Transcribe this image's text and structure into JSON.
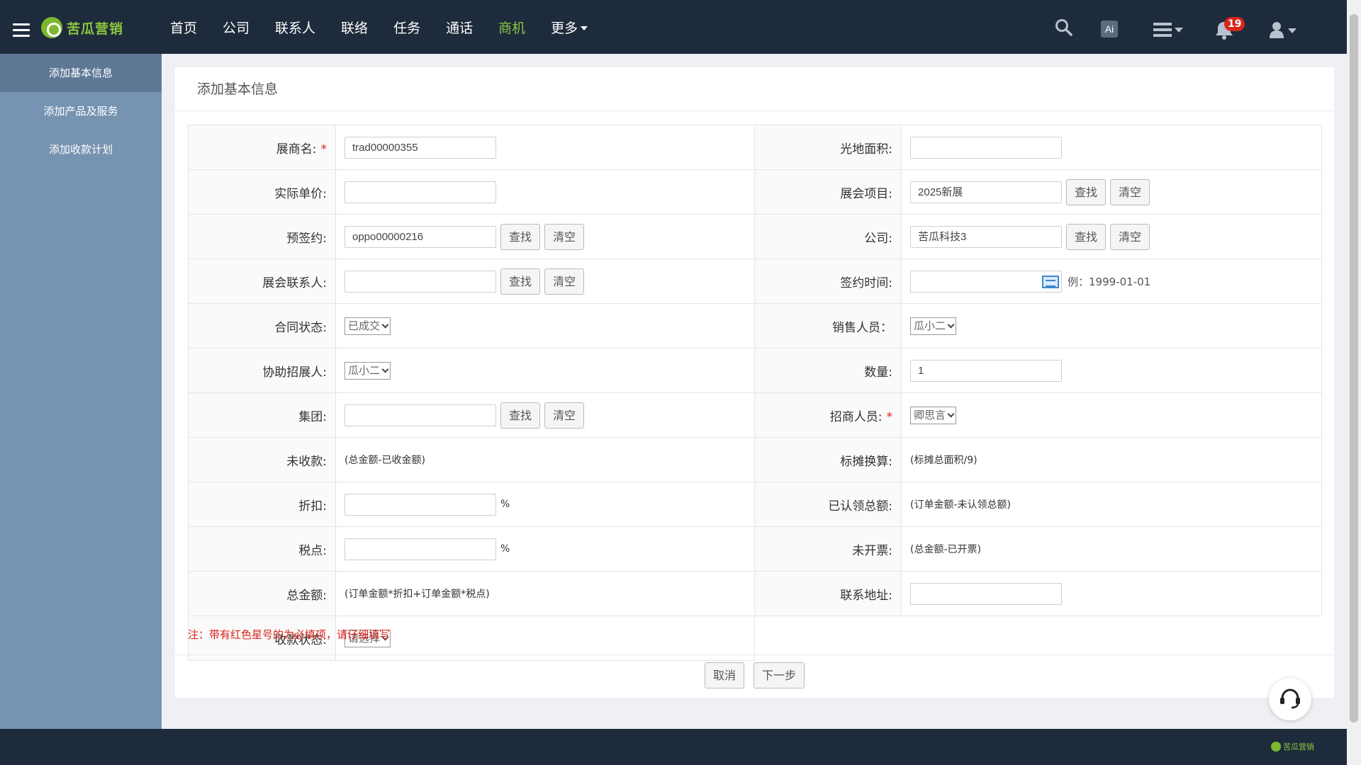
{
  "topbar": {
    "logo_text": "苦瓜营销",
    "nav": [
      {
        "label": "首页",
        "active": false
      },
      {
        "label": "公司",
        "active": false
      },
      {
        "label": "联系人",
        "active": false
      },
      {
        "label": "联络",
        "active": false
      },
      {
        "label": "任务",
        "active": false
      },
      {
        "label": "通话",
        "active": false
      },
      {
        "label": "商机",
        "active": true
      },
      {
        "label": "更多",
        "active": false,
        "dropdown": true
      }
    ],
    "ai_label": "Ai",
    "notification_count": "19"
  },
  "sidebar": {
    "items": [
      {
        "label": "添加基本信息",
        "active": true
      },
      {
        "label": "添加产品及服务",
        "active": false
      },
      {
        "label": "添加收款计划",
        "active": false
      }
    ]
  },
  "page": {
    "title": "添加基本信息",
    "search_label": "查找",
    "clear_label": "清空",
    "note": "注：带有红色星号的为必填项，请仔细填写",
    "cancel_label": "取消",
    "next_label": "下一步"
  },
  "form": {
    "exhibitor_name": {
      "label": "展商名:",
      "value": "trad00000355",
      "required": true
    },
    "raw_space_area": {
      "label": "光地面积:",
      "value": ""
    },
    "actual_unit_price": {
      "label": "实际单价:",
      "value": ""
    },
    "exhibition_project": {
      "label": "展会项目:",
      "value": "2025新展"
    },
    "pre_contract": {
      "label": "预签约:",
      "value": "oppo00000216"
    },
    "company": {
      "label": "公司:",
      "value": "苦瓜科技3"
    },
    "exhibition_contact": {
      "label": "展会联系人:",
      "value": ""
    },
    "sign_time": {
      "label": "签约时间:",
      "value": "",
      "hint": "例：1999-01-01"
    },
    "contract_status": {
      "label": "合同状态:",
      "selected": "已成交"
    },
    "sales_person": {
      "label": "销售人员：",
      "selected": "瓜小二"
    },
    "assist_recruiter": {
      "label": "协助招展人:",
      "selected": "瓜小二"
    },
    "quantity": {
      "label": "数量:",
      "value": "1"
    },
    "group": {
      "label": "集团:",
      "value": ""
    },
    "investment_person": {
      "label": "招商人员:",
      "selected": "卿思言",
      "required": true
    },
    "unreceived": {
      "label": "未收款:",
      "formula": "(总金额-已收金额)"
    },
    "booth_conversion": {
      "label": "标摊换算:",
      "formula": "(标摊总面积/9)"
    },
    "discount": {
      "label": "折扣:",
      "value": "",
      "unit": "%"
    },
    "claimed_total": {
      "label": "已认领总额:",
      "formula": "(订单金额-未认领总额)"
    },
    "tax_rate": {
      "label": "税点:",
      "value": "",
      "unit": "%"
    },
    "uninvoiced": {
      "label": "未开票:",
      "formula": "(总金额-已开票)"
    },
    "total_amount": {
      "label": "总金额:",
      "formula": "(订单金额*折扣+订单金额*税点)"
    },
    "contact_address": {
      "label": "联系地址:",
      "value": ""
    },
    "payment_status": {
      "label": "收款状态:",
      "selected": "请选择"
    }
  },
  "footer": {
    "logo_text": "苦瓜营销"
  }
}
